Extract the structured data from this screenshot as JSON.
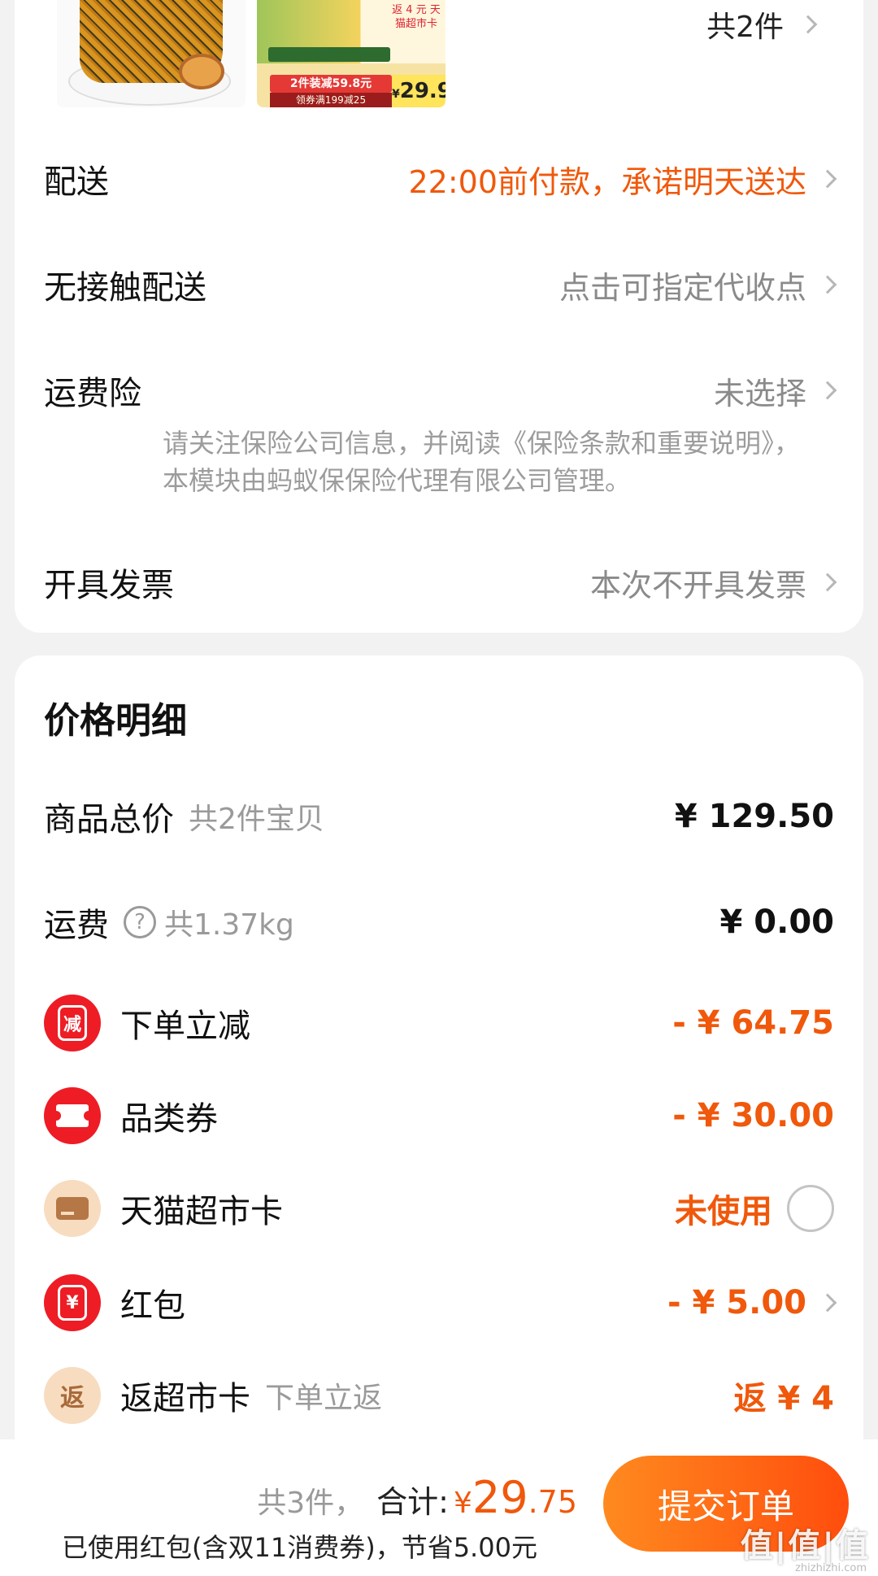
{
  "order": {
    "item_count": "共2件",
    "thumb_2": {
      "promo": "2件装减59.8元",
      "coupon": "领券满199减25",
      "price_symbol": "¥",
      "price": "29.9",
      "side_text": "返 4 元 天猫超市卡"
    },
    "delivery": {
      "label": "配送",
      "value": "22:00前付款，承诺明天送达"
    },
    "contactless": {
      "label": "无接触配送",
      "value": "点击可指定代收点"
    },
    "shipping_insurance": {
      "label": "运费险",
      "value": "未选择",
      "note": "请关注保险公司信息，并阅读《保险条款和重要说明》，本模块由蚂蚁保保险代理有限公司管理。"
    },
    "invoice": {
      "label": "开具发票",
      "value": "本次不开具发票"
    }
  },
  "price_detail": {
    "title": "价格明细",
    "goods_total": {
      "label": "商品总价",
      "sub": "共2件宝贝",
      "amount": "¥ 129.50"
    },
    "shipping": {
      "label": "运费",
      "help": "?",
      "sub": "共1.37kg",
      "amount": "¥ 0.00"
    },
    "instant_discount": {
      "icon": "减",
      "label": "下单立减",
      "amount": "- ¥ 64.75"
    },
    "category_coupon": {
      "label": "品类券",
      "amount": "- ¥ 30.00"
    },
    "tmall_card": {
      "label": "天猫超市卡",
      "status": "未使用"
    },
    "red_packet": {
      "icon": "¥",
      "label": "红包",
      "amount": "- ¥ 5.00"
    },
    "cashback_card": {
      "icon": "返",
      "label": "返超市卡",
      "sub": "下单立返",
      "amount": "返 ¥ 4"
    }
  },
  "bottom_bar": {
    "count": "共3件，",
    "total_label": "合计:",
    "currency": "¥",
    "total_int": "29",
    "total_dec": ".75",
    "savings_note": "已使用红包(含双11消费券)，节省5.00元",
    "submit_label": "提交订单",
    "watermark": "值|值|值",
    "watermark_url": "zhizhizhi.com"
  },
  "colors": {
    "accent": "#f0580b",
    "red_icon": "#ee1c25",
    "beige_icon": "#f7dcc0"
  }
}
